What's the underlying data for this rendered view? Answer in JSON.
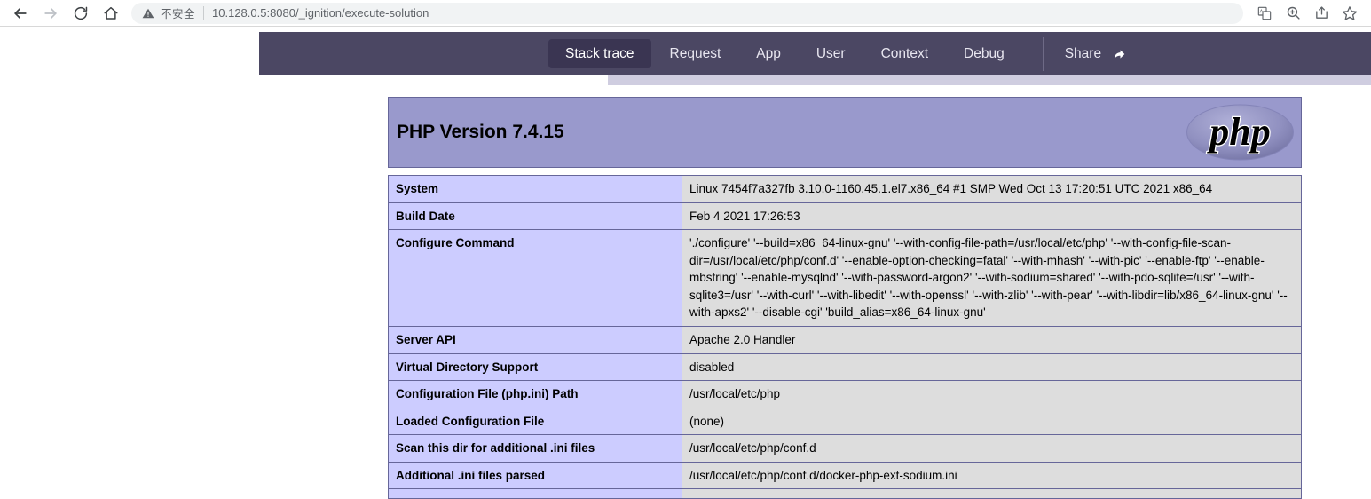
{
  "browser": {
    "back_icon": "arrow-left-icon",
    "forward_icon": "arrow-right-icon",
    "reload_icon": "reload-icon",
    "home_icon": "home-icon",
    "security_label": "不安全",
    "url": "10.128.0.5:8080/_ignition/execute-solution",
    "toolbar_icons": [
      "translate-icon",
      "zoom-icon",
      "share-icon",
      "bookmark-star-icon"
    ]
  },
  "ignition": {
    "tabs": [
      {
        "label": "Stack trace",
        "active": true
      },
      {
        "label": "Request",
        "active": false
      },
      {
        "label": "App",
        "active": false
      },
      {
        "label": "User",
        "active": false
      },
      {
        "label": "Context",
        "active": false
      },
      {
        "label": "Debug",
        "active": false
      }
    ],
    "share_label": "Share",
    "share_icon": "share-arrow-icon"
  },
  "phpinfo": {
    "version_title": "PHP Version 7.4.15",
    "logo_text": "php",
    "rows": [
      {
        "key": "System",
        "value": "Linux 7454f7a327fb 3.10.0-1160.45.1.el7.x86_64 #1 SMP Wed Oct 13 17:20:51 UTC 2021 x86_64"
      },
      {
        "key": "Build Date",
        "value": "Feb 4 2021 17:26:53"
      },
      {
        "key": "Configure Command",
        "value": "'./configure'  '--build=x86_64-linux-gnu' '--with-config-file-path=/usr/local/etc/php' '--with-config-file-scan-dir=/usr/local/etc/php/conf.d' '--enable-option-checking=fatal' '--with-mhash' '--with-pic' '--enable-ftp' '--enable-mbstring' '--enable-mysqlnd' '--with-password-argon2' '--with-sodium=shared' '--with-pdo-sqlite=/usr' '--with-sqlite3=/usr' '--with-curl' '--with-libedit' '--with-openssl' '--with-zlib' '--with-pear' '--with-libdir=lib/x86_64-linux-gnu' '--with-apxs2' '--disable-cgi' 'build_alias=x86_64-linux-gnu'"
      },
      {
        "key": "Server API",
        "value": "Apache 2.0 Handler"
      },
      {
        "key": "Virtual Directory Support",
        "value": "disabled"
      },
      {
        "key": "Configuration File (php.ini) Path",
        "value": "/usr/local/etc/php"
      },
      {
        "key": "Loaded Configuration File",
        "value": "(none)"
      },
      {
        "key": "Scan this dir for additional .ini files",
        "value": "/usr/local/etc/php/conf.d"
      },
      {
        "key": "Additional .ini files parsed",
        "value": "/usr/local/etc/php/conf.d/docker-php-ext-sodium.ini"
      },
      {
        "key": "",
        "value": ""
      }
    ]
  },
  "colors": {
    "nav_bar": "#4b4763",
    "nav_active_tab": "#3a3552",
    "php_header": "#9999cc",
    "php_key_cell": "#ccccff",
    "php_value_cell": "#dddddd",
    "php_border": "#666699"
  }
}
